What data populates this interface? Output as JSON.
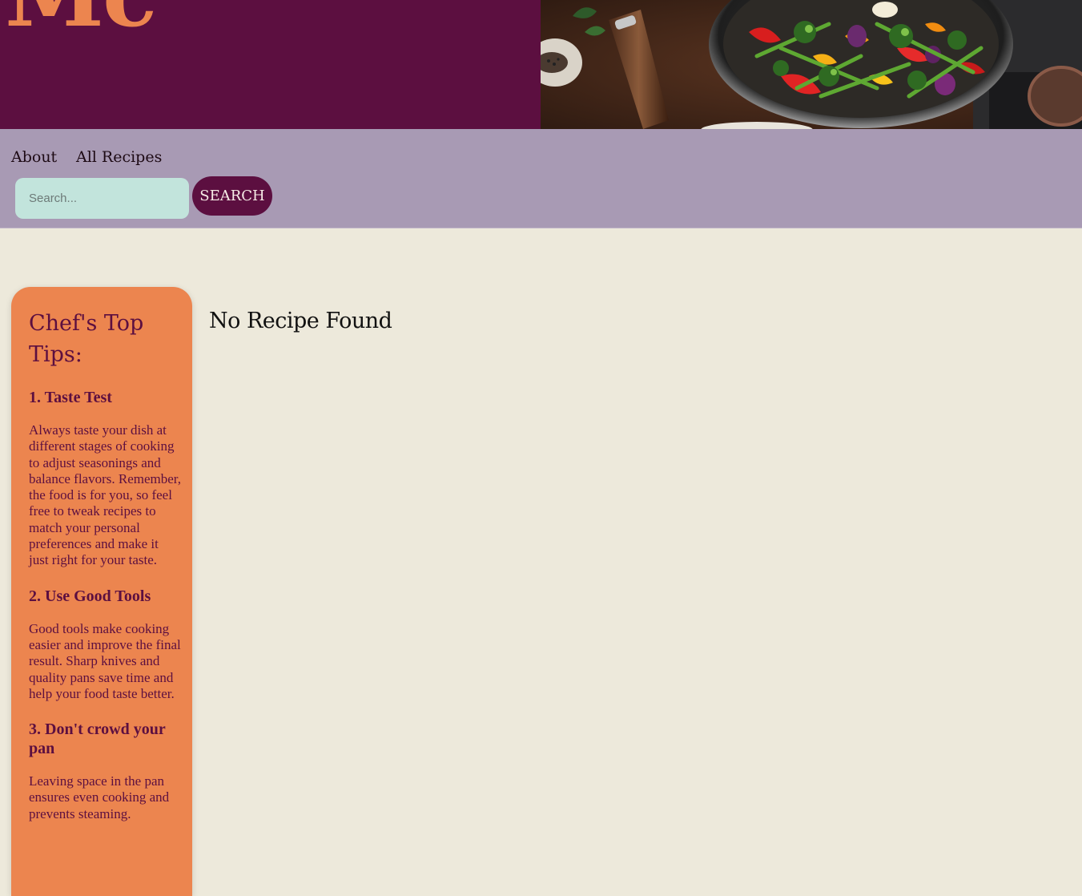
{
  "header": {
    "logo_text": "Mc",
    "hero_image": "stir-fry vegetables in pan"
  },
  "nav": {
    "links": [
      {
        "label": "About"
      },
      {
        "label": "All Recipes"
      }
    ]
  },
  "search": {
    "placeholder": "Search...",
    "value": "",
    "button_label": "SEARCH"
  },
  "sidebar": {
    "title": "Chef's Top Tips:",
    "tips": [
      {
        "heading": "1. Taste Test",
        "text": "Always taste your dish at different stages of cooking to adjust seasonings and balance flavors. Remember, the food is for you, so feel free to tweak recipes to match your personal preferences and make it just right for your taste."
      },
      {
        "heading": "2. Use Good Tools",
        "text": "Good tools make cooking easier and improve the final result. Sharp knives and quality pans save time and help your food taste better."
      },
      {
        "heading": "3. Don't crowd your pan",
        "text": "Leaving space in the pan ensures even cooking and prevents steaming."
      }
    ]
  },
  "main": {
    "message": "No Recipe Found"
  },
  "colors": {
    "header_bg": "#5c0f40",
    "logo": "#ec854f",
    "nav_bg": "#a89ab4",
    "search_bg": "#c2e4dc",
    "sidebar_bg": "#ec854f",
    "page_bg": "#ede9db"
  }
}
